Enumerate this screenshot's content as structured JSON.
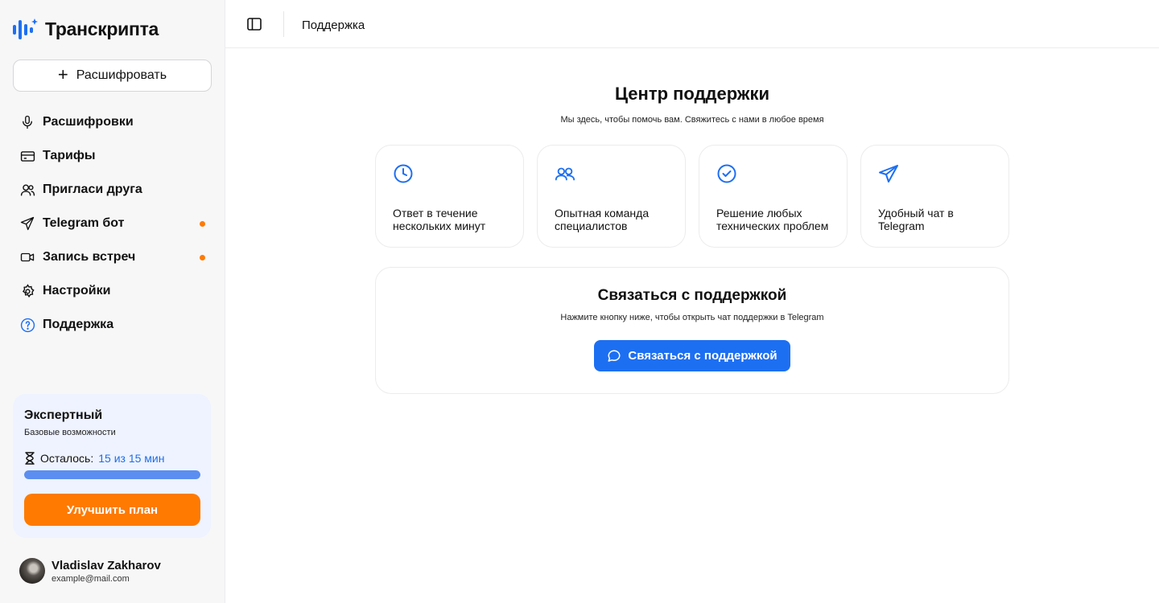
{
  "app": {
    "name": "Транскрипта"
  },
  "sidebar": {
    "new_button_label": "Расшифровать",
    "items": [
      {
        "label": "Расшифровки",
        "icon": "microphone-icon",
        "dot": false
      },
      {
        "label": "Тарифы",
        "icon": "card-icon",
        "dot": false
      },
      {
        "label": "Пригласи друга",
        "icon": "users-icon",
        "dot": false
      },
      {
        "label": "Telegram бот",
        "icon": "send-icon",
        "dot": true
      },
      {
        "label": "Запись встреч",
        "icon": "video-icon",
        "dot": true
      },
      {
        "label": "Настройки",
        "icon": "gear-icon",
        "dot": false
      },
      {
        "label": "Поддержка",
        "icon": "help-circle-icon",
        "dot": false,
        "active": true
      }
    ],
    "plan": {
      "name": "Экспертный",
      "description": "Базовые возможности",
      "remaining_label": "Осталось:",
      "remaining_value": "15 из 15 мин",
      "progress_fraction": 1.0,
      "upgrade_label": "Улучшить план"
    },
    "user": {
      "name": "Vladislav Zakharov",
      "email": "example@mail.com"
    }
  },
  "topbar": {
    "breadcrumb": "Поддержка"
  },
  "main": {
    "title": "Центр поддержки",
    "subtitle": "Мы здесь, чтобы помочь вам. Свяжитесь с нами в любое время",
    "features": [
      {
        "text": "Ответ в течение нескольких минут",
        "icon": "clock-icon"
      },
      {
        "text": "Опытная команда специалистов",
        "icon": "team-icon"
      },
      {
        "text": "Решение любых технических проблем",
        "icon": "check-circle-icon"
      },
      {
        "text": "Удобный чат в Telegram",
        "icon": "telegram-icon"
      }
    ],
    "contact": {
      "title": "Связаться с поддержкой",
      "subtitle": "Нажмите кнопку ниже, чтобы открыть чат поддержки в Telegram",
      "button_label": "Связаться с поддержкой"
    }
  },
  "colors": {
    "accent": "#1d6ff2",
    "orange": "#ff7a00",
    "plan_bg": "#eef3ff"
  }
}
